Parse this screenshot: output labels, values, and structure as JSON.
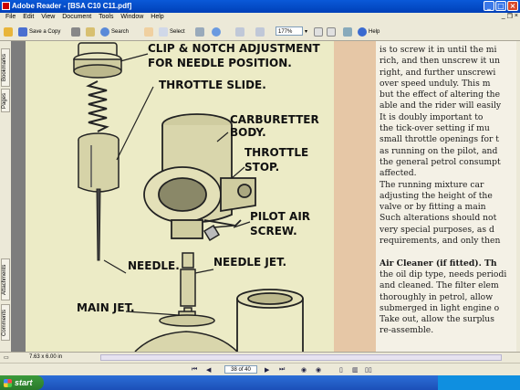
{
  "window": {
    "title": "Adobe Reader - [BSA C10 C11.pdf]"
  },
  "menu": [
    "File",
    "Edit",
    "View",
    "Document",
    "Tools",
    "Window",
    "Help"
  ],
  "toolbar": {
    "save_copy": "Save a Copy",
    "search": "Search",
    "select": "Select",
    "zoom": "177%",
    "help": "Help"
  },
  "left_tabs": {
    "bookmarks": "Bookmarks",
    "pages": "Pages",
    "attachments": "Attachments",
    "comments": "Comments"
  },
  "diagram": {
    "labels": {
      "clip_notch": "CLIP & NOTCH ADJUSTMENT",
      "needle_position": "FOR NEEDLE POSITION.",
      "throttle_slide": "THROTTLE SLIDE.",
      "carburetter": "CARBURETTER",
      "body": "BODY.",
      "throttle": "THROTTLE",
      "stop": "STOP.",
      "pilot_air": "PILOT AIR",
      "screw": "SCREW.",
      "needle": "NEEDLE.",
      "needle_jet": "NEEDLE JET.",
      "main_jet": "MAIN JET."
    }
  },
  "text_lines": [
    "is to screw it in until the mi",
    "rich, and then unscrew it un",
    "right, and further unscrewi",
    "over speed unduly.  This m",
    "but the effect of altering the",
    "able and the rider will easily",
    "   It is doubly important to",
    "the tick-over setting if mu",
    "small throttle openings for t",
    "as running on the pilot, and",
    "the general petrol consumpt",
    "affected.",
    "   The running mixture car",
    "adjusting the height of the",
    "valve or by fitting a main",
    "Such alterations should not",
    "very special purposes, as d",
    "requirements, and only then",
    "",
    "Air Cleaner (if fitted).   Th",
    "the oil dip type, needs periodi",
    "and cleaned.  The filter elem",
    "thoroughly in petrol, allow",
    "submerged in light engine o",
    "Take out, allow the surplus",
    "re-assemble."
  ],
  "status": {
    "page_size": "7.63 x 6.00 in"
  },
  "nav": {
    "page_indicator": "38 of 40"
  },
  "taskbar": {
    "start": "start"
  }
}
